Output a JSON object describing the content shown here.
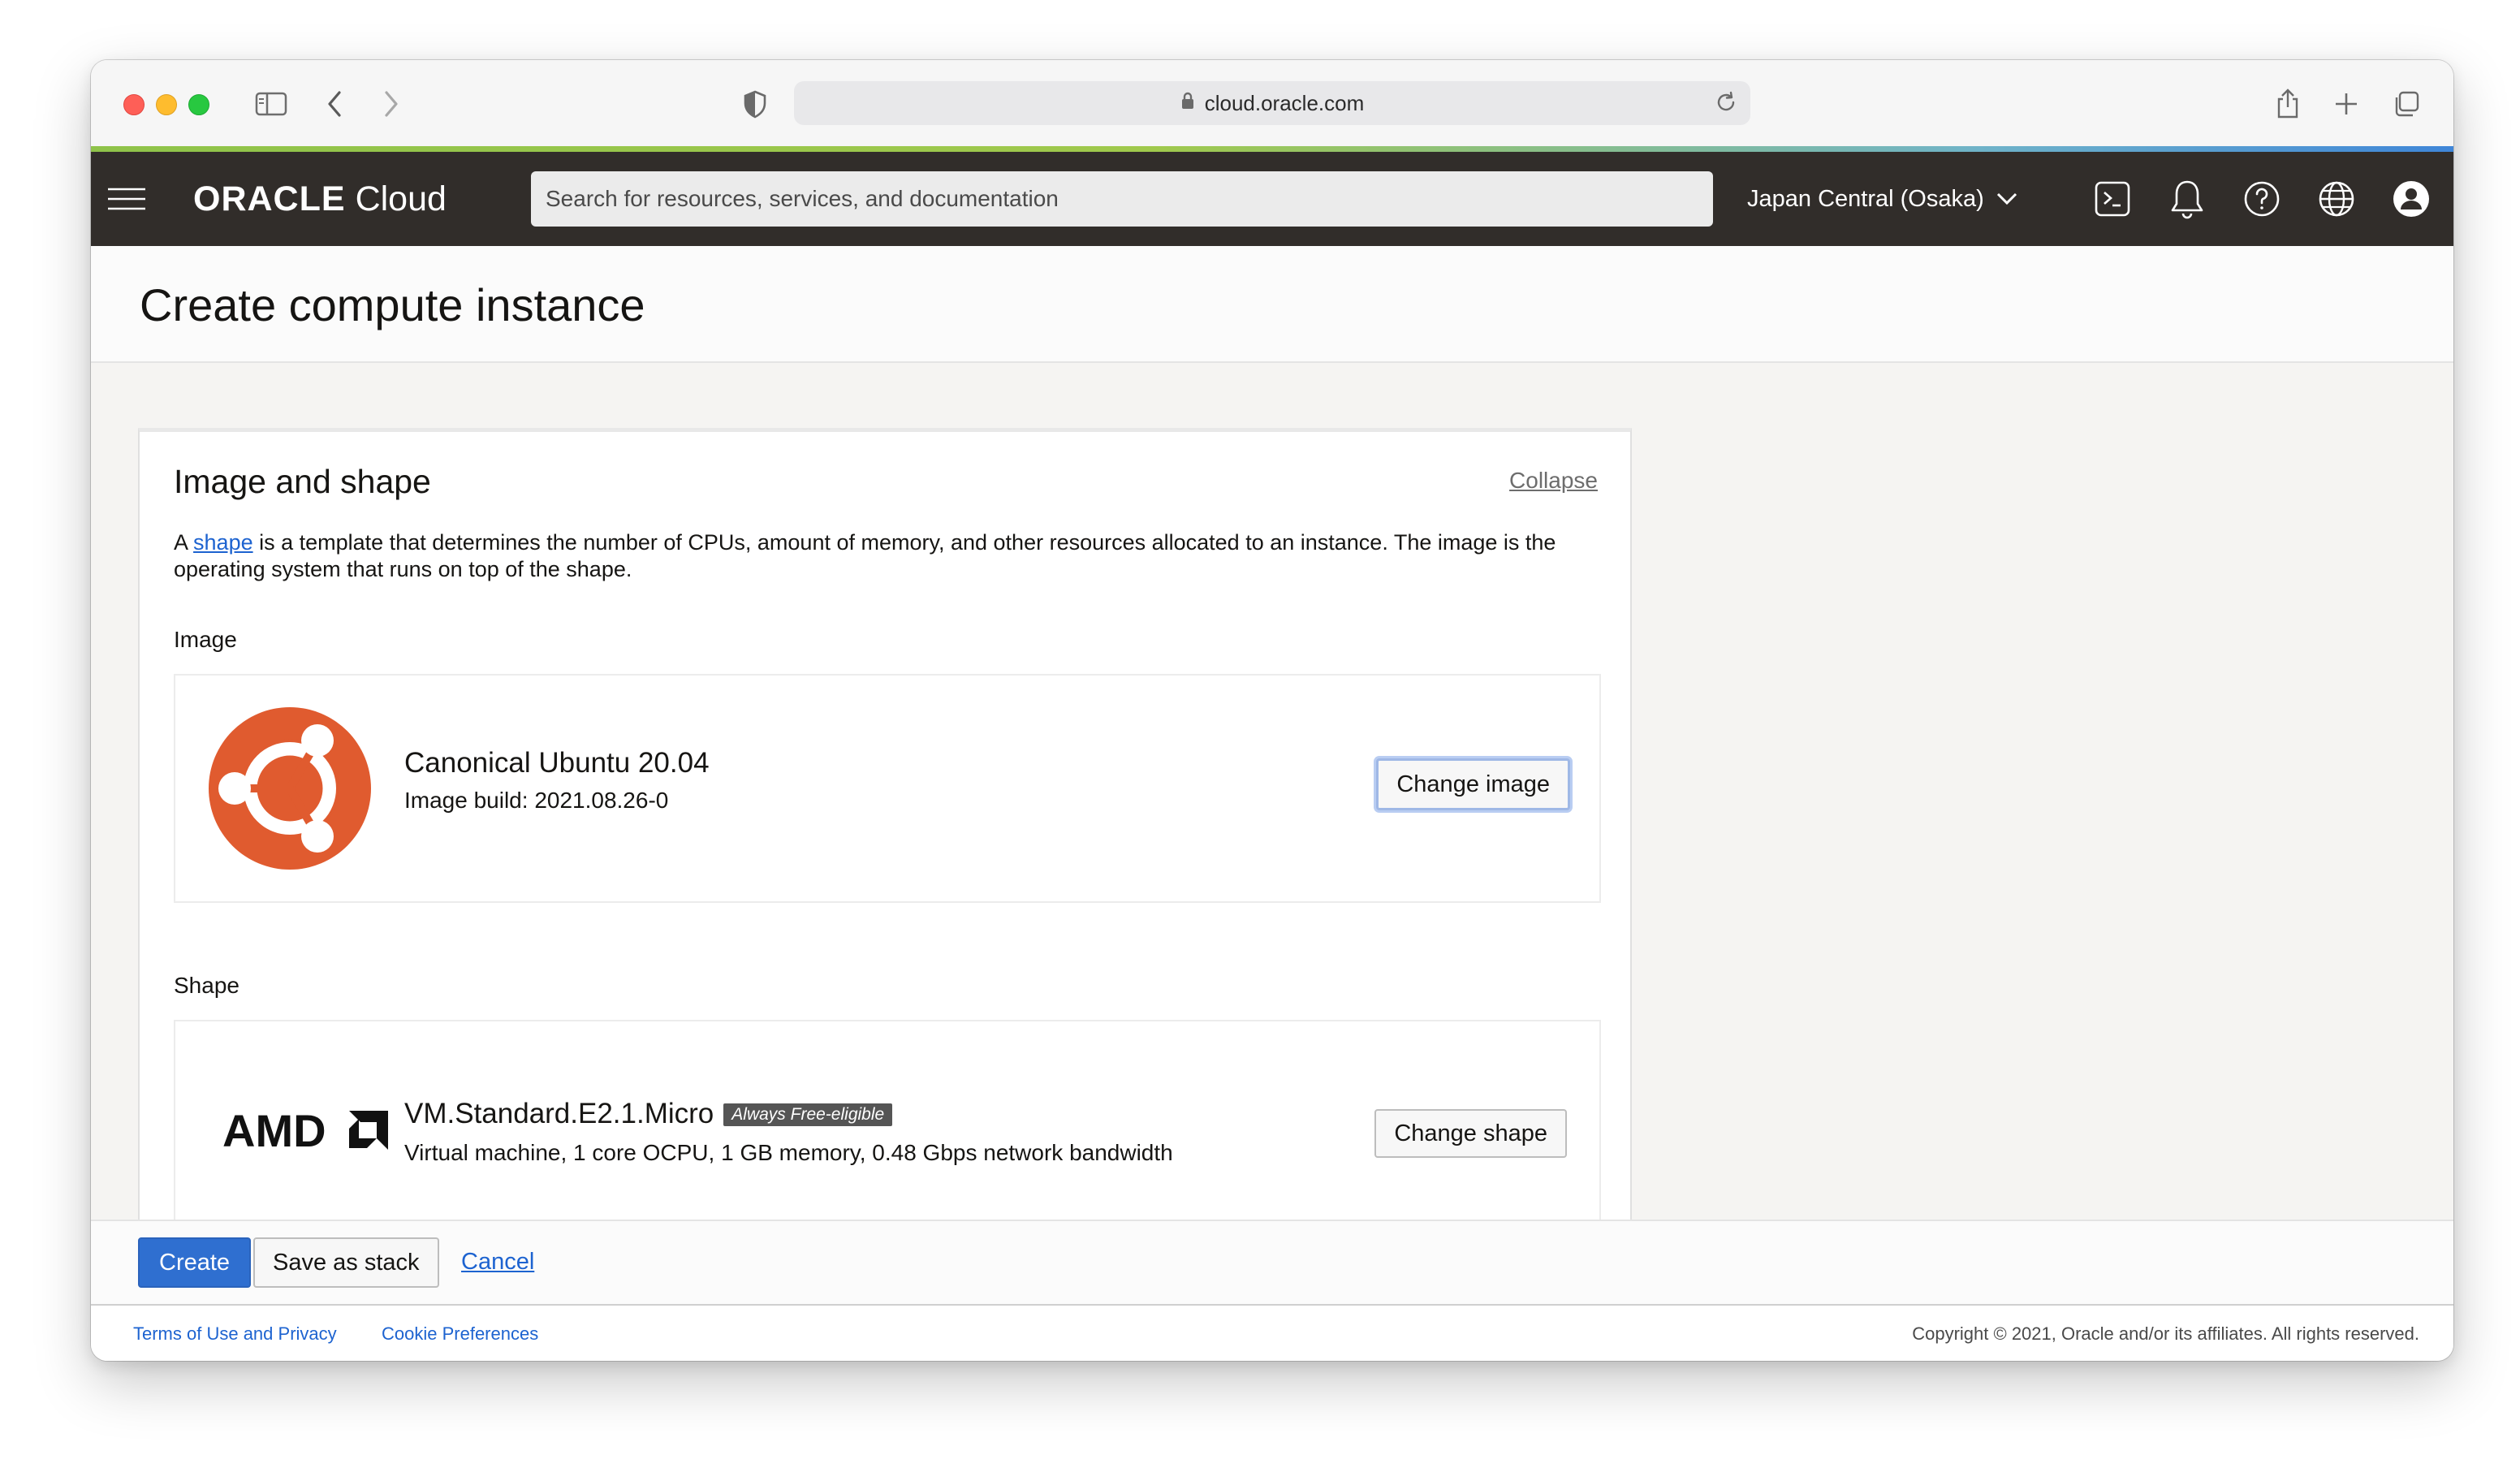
{
  "browser": {
    "url": "cloud.oracle.com"
  },
  "header": {
    "brand_oracle": "ORACLE",
    "brand_cloud": "Cloud",
    "search_placeholder": "Search for resources, services, and documentation",
    "region": "Japan Central (Osaka)"
  },
  "page": {
    "title": "Create compute instance"
  },
  "section": {
    "title": "Image and shape",
    "collapse_label": "Collapse",
    "desc_prefix": "A ",
    "desc_link": "shape",
    "desc_rest": " is a template that determines the number of CPUs, amount of memory, and other resources allocated to an instance. The image is the operating system that runs on top of the shape.",
    "image": {
      "label": "Image",
      "name": "Canonical Ubuntu 20.04",
      "build": "Image build: 2021.08.26-0",
      "button": "Change image",
      "logo_color": "#e05b2f"
    },
    "shape": {
      "label": "Shape",
      "vendor": "AMD",
      "name": "VM.Standard.E2.1.Micro",
      "badge": "Always Free-eligible",
      "details": "Virtual machine, 1 core OCPU, 1 GB memory, 0.48 Gbps network bandwidth",
      "button": "Change shape"
    }
  },
  "actions": {
    "create": "Create",
    "save_stack": "Save as stack",
    "cancel": "Cancel"
  },
  "footer": {
    "terms": "Terms of Use and Privacy",
    "cookies": "Cookie Preferences",
    "copyright": "Copyright © 2021, Oracle and/or its affiliates. All rights reserved."
  },
  "colors": {
    "header_bg": "#312d2a",
    "primary": "#2f6fd0",
    "link": "#1d63d0"
  }
}
